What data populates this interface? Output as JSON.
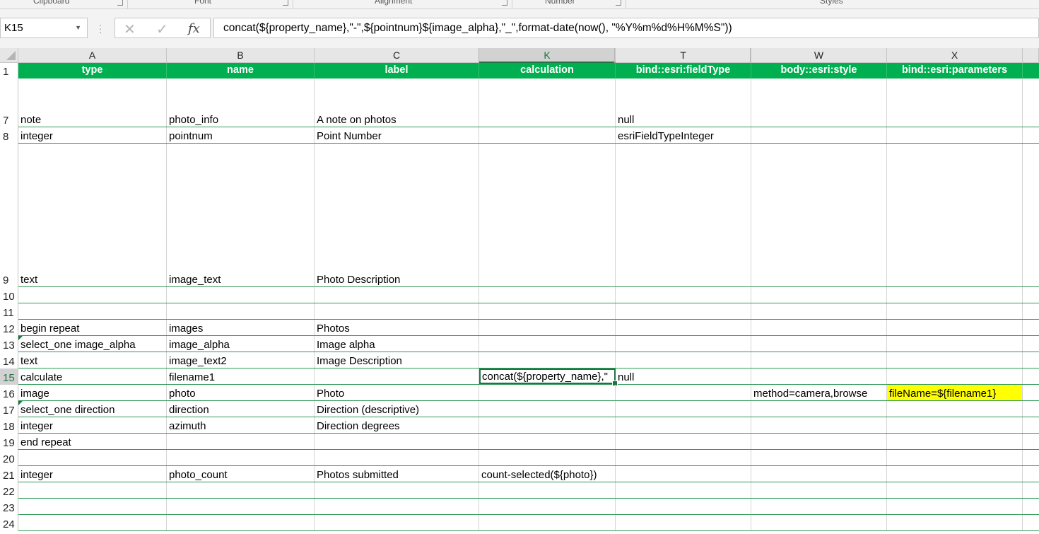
{
  "ribbon": {
    "groups": [
      "Clipboard",
      "Font",
      "Alignment",
      "Number",
      "Styles"
    ]
  },
  "formula_bar": {
    "name_box": "K15",
    "cancel_icon": "✕",
    "enter_icon": "✓",
    "fx_label": "fx",
    "formula": "concat(${property_name},\"-\",${pointnum}${image_alpha},\"_\",format-date(now(), \"%Y%m%d%H%M%S\"))"
  },
  "columns": [
    {
      "letter": "A",
      "header": "type"
    },
    {
      "letter": "B",
      "header": "name"
    },
    {
      "letter": "C",
      "header": "label"
    },
    {
      "letter": "K",
      "header": "calculation"
    },
    {
      "letter": "T",
      "header": "bind::esri:fieldType"
    },
    {
      "letter": "W",
      "header": "body::esri:style"
    },
    {
      "letter": "X",
      "header": "bind::esri:parameters"
    }
  ],
  "header_row_number": "1",
  "rows": [
    {
      "num": "7",
      "cells": [
        "note",
        "photo_info",
        "A note on photos",
        "",
        "null",
        "",
        ""
      ]
    },
    {
      "num": "8",
      "cells": [
        "integer",
        "pointnum",
        "Point Number",
        "",
        "esriFieldTypeInteger",
        "",
        ""
      ]
    },
    {
      "num": "9",
      "cells": [
        "text",
        "image_text",
        "Photo Description",
        "",
        "",
        "",
        ""
      ]
    },
    {
      "num": "10",
      "cells": [
        "",
        "",
        "",
        "",
        "",
        "",
        ""
      ]
    },
    {
      "num": "11",
      "cells": [
        "",
        "",
        "",
        "",
        "",
        "",
        ""
      ]
    },
    {
      "num": "12",
      "cells": [
        "begin repeat",
        "images",
        "Photos",
        "",
        "",
        "",
        ""
      ]
    },
    {
      "num": "13",
      "cells": [
        "select_one image_alpha",
        "image_alpha",
        "Image alpha",
        "",
        "",
        "",
        ""
      ]
    },
    {
      "num": "14",
      "cells": [
        "text",
        "image_text2",
        "Image Description",
        "",
        "",
        "",
        ""
      ]
    },
    {
      "num": "15",
      "cells": [
        "calculate",
        "filename1",
        "",
        "concat(${property_name},\"",
        "null",
        "",
        ""
      ]
    },
    {
      "num": "16",
      "cells": [
        "image",
        "photo",
        "Photo",
        "",
        "",
        "method=camera,browse",
        "fileName=${filename1}"
      ]
    },
    {
      "num": "17",
      "cells": [
        "select_one direction",
        "direction",
        "Direction (descriptive)",
        "",
        "",
        "",
        ""
      ]
    },
    {
      "num": "18",
      "cells": [
        "integer",
        "azimuth",
        "Direction degrees",
        "",
        "",
        "",
        ""
      ]
    },
    {
      "num": "19",
      "cells": [
        "end repeat",
        "",
        "",
        "",
        "",
        "",
        ""
      ]
    },
    {
      "num": "20",
      "cells": [
        "",
        "",
        "",
        "",
        "",
        "",
        ""
      ]
    },
    {
      "num": "21",
      "cells": [
        "integer",
        "photo_count",
        "Photos submitted",
        "count-selected(${photo})",
        "",
        "",
        ""
      ]
    },
    {
      "num": "22",
      "cells": [
        "",
        "",
        "",
        "",
        "",
        "",
        ""
      ]
    },
    {
      "num": "23",
      "cells": [
        "",
        "",
        "",
        "",
        "",
        "",
        ""
      ]
    },
    {
      "num": "24",
      "cells": [
        "",
        "",
        "",
        "",
        "",
        "",
        ""
      ]
    }
  ],
  "colors": {
    "header_fill": "#00b050",
    "row_border": "#2e9a55",
    "highlight": "#ffff00",
    "selection": "#217346"
  }
}
